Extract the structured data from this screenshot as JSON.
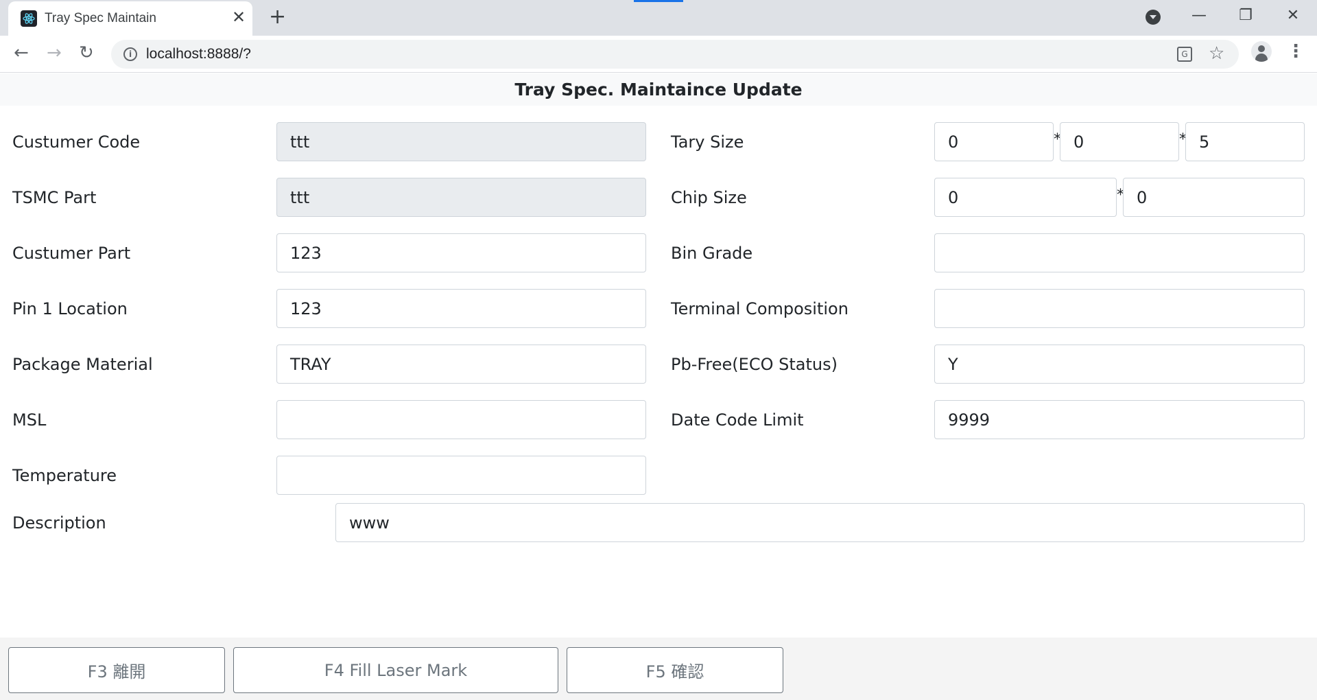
{
  "browser": {
    "tab_title": "Tray Spec Maintain",
    "url": "localhost:8888/?"
  },
  "page": {
    "title": "Tray Spec. Maintaince Update"
  },
  "form": {
    "customer_code": {
      "label": "Custumer Code",
      "value": "ttt"
    },
    "tsmc_part": {
      "label": "TSMC Part",
      "value": "ttt"
    },
    "customer_part": {
      "label": "Custumer Part",
      "value": "123"
    },
    "pin1_location": {
      "label": "Pin 1 Location",
      "value": "123"
    },
    "package_material": {
      "label": "Package Material",
      "value": "TRAY"
    },
    "msl": {
      "label": "MSL",
      "value": ""
    },
    "temperature": {
      "label": "Temperature",
      "value": ""
    },
    "description": {
      "label": "Description",
      "value": "www"
    },
    "tray_size": {
      "label": "Tary Size",
      "values": [
        "0",
        "0",
        "5"
      ],
      "separator": "*"
    },
    "chip_size": {
      "label": "Chip Size",
      "values": [
        "0",
        "0"
      ],
      "separator": "*"
    },
    "bin_grade": {
      "label": "Bin Grade",
      "value": ""
    },
    "terminal_composition": {
      "label": "Terminal Composition",
      "value": ""
    },
    "pb_free": {
      "label": "Pb-Free(ECO Status)",
      "value": "Y"
    },
    "date_code_limit": {
      "label": "Date Code Limit",
      "value": "9999"
    }
  },
  "footer": {
    "exit_label": "F3 離開",
    "laser_label": "F4 Fill Laser Mark",
    "confirm_label": "F5 確認"
  },
  "colors": {
    "readonly_bg": "#e9ecef",
    "border": "#ced4da",
    "button_text": "#6c757d"
  }
}
